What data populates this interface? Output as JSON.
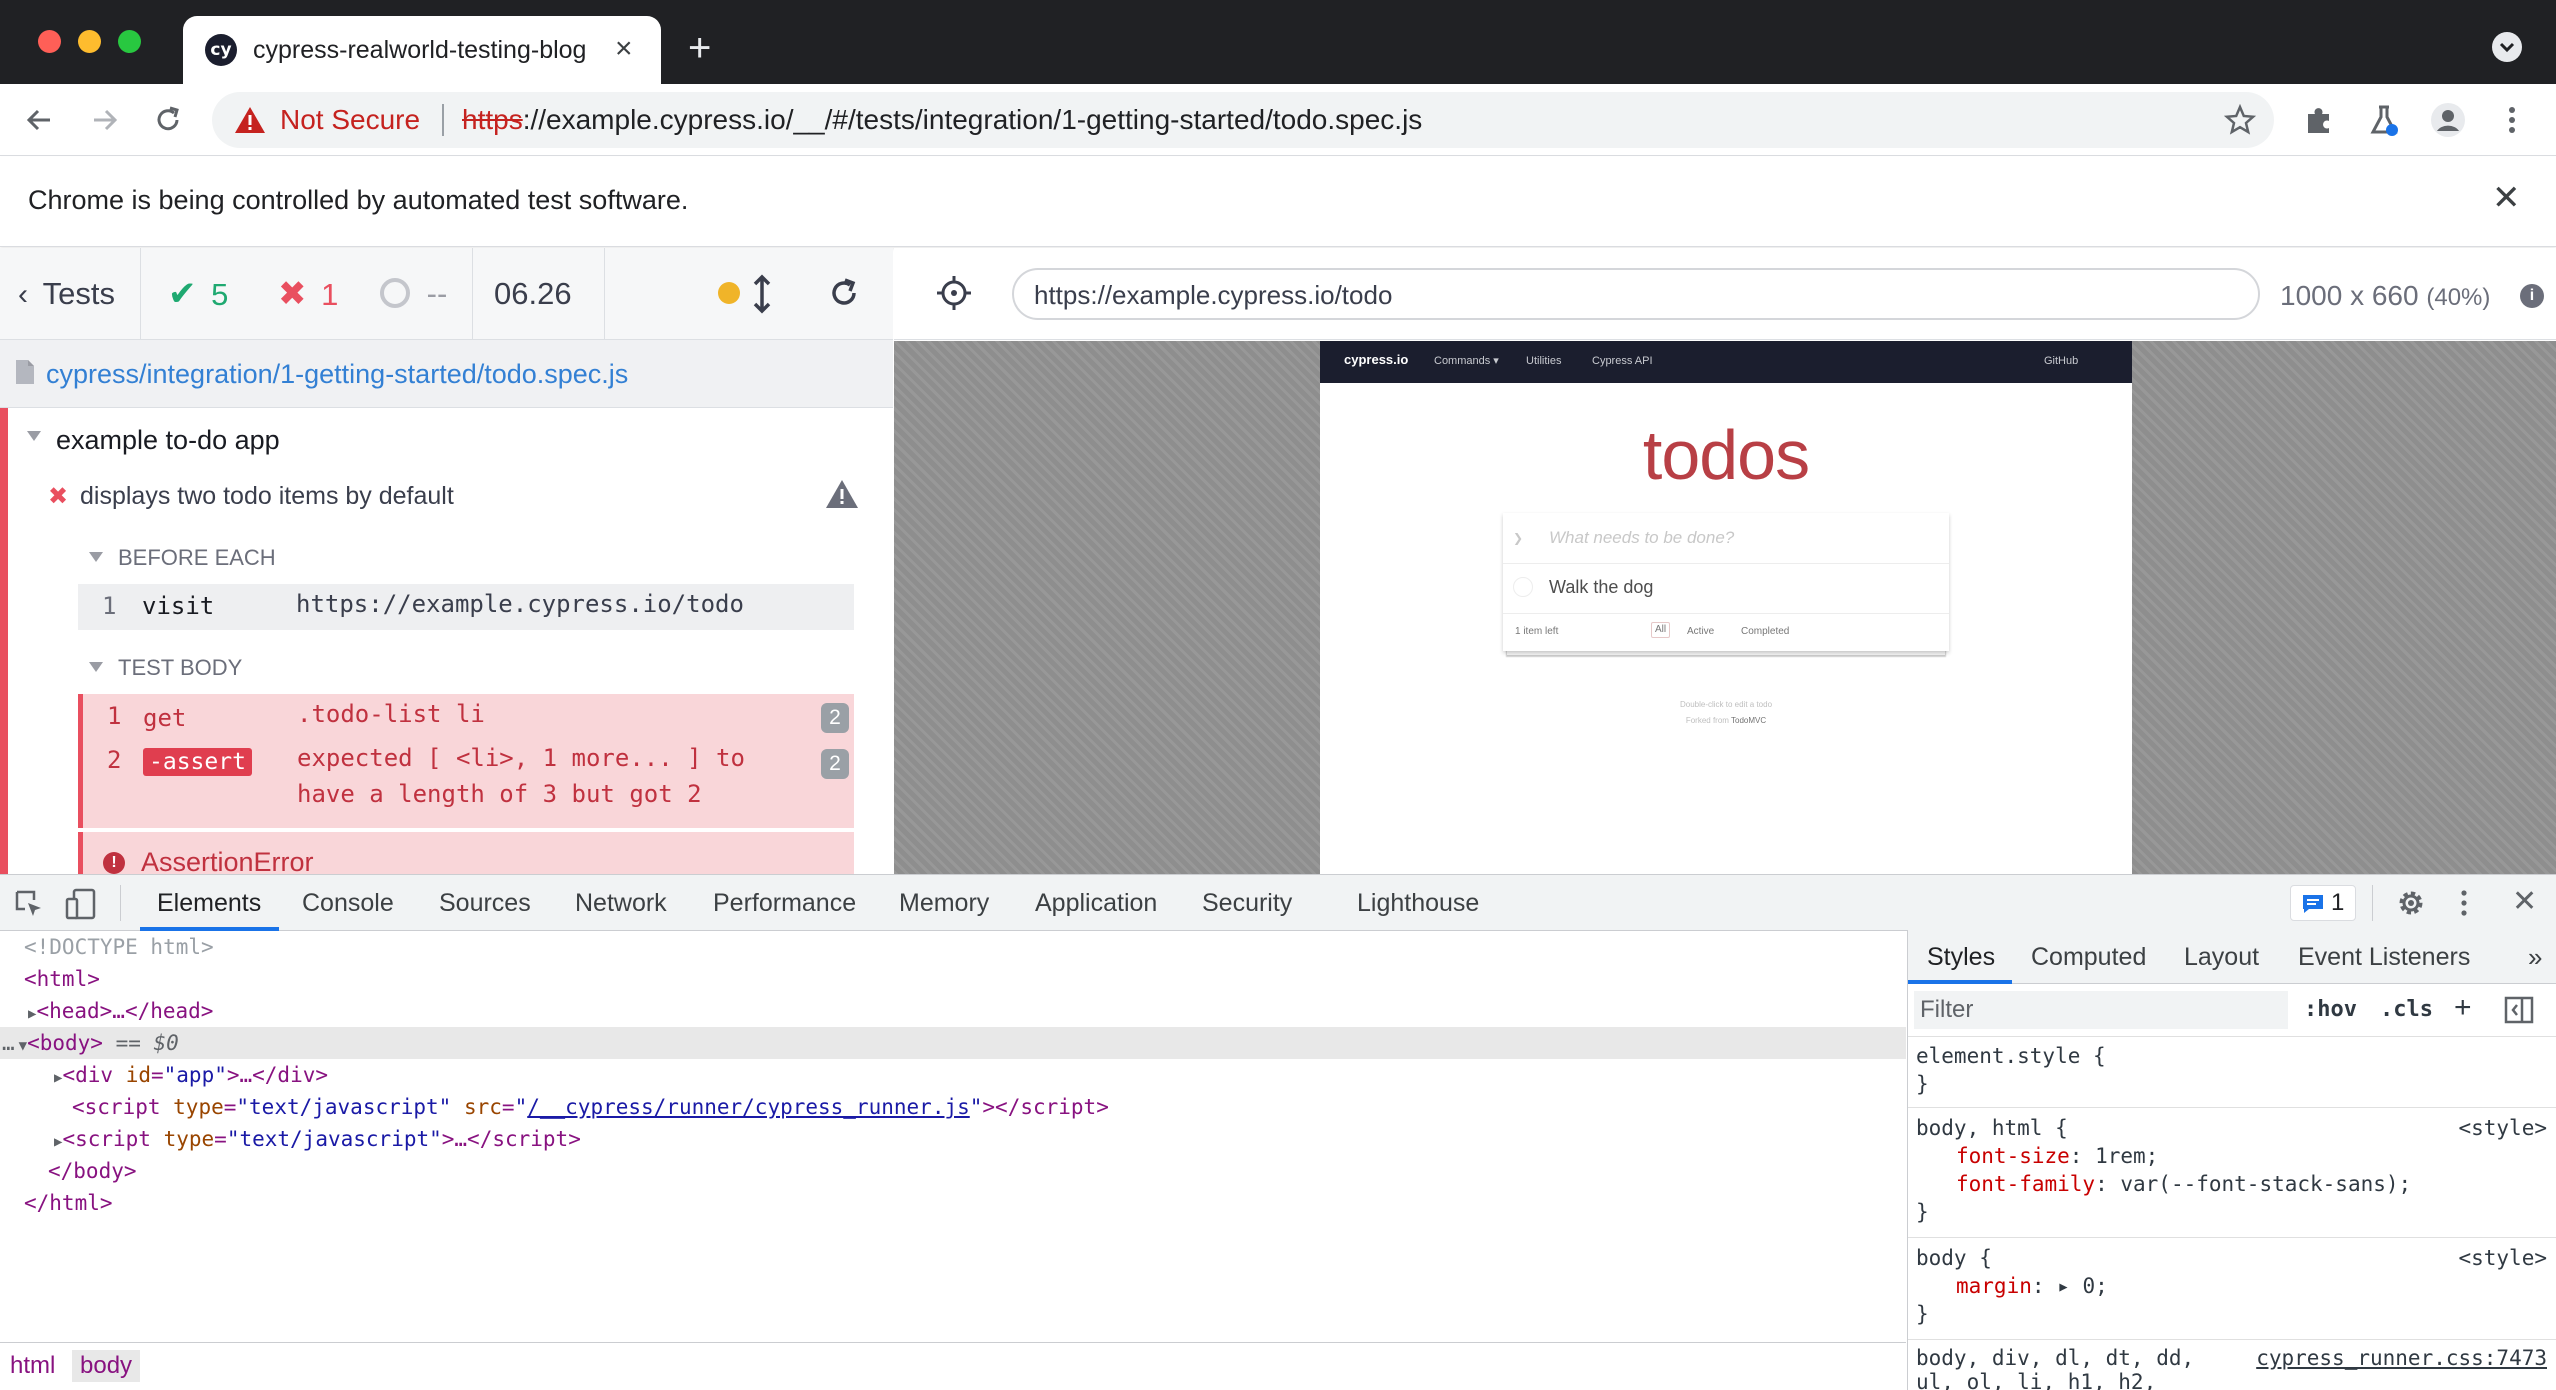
{
  "browser": {
    "tab_title": "cypress-realworld-testing-blog",
    "favicon_label": "cy",
    "url_security": "Not Secure",
    "url_scheme": "https",
    "url_rest": "://example.cypress.io/__/#/tests/integration/1-getting-started/todo.spec.js",
    "infobar_text": "Chrome is being controlled by automated test software."
  },
  "reporter": {
    "tests_label": "Tests",
    "passed": "5",
    "failed": "1",
    "pending": "--",
    "duration": "06.26",
    "spec_path": "cypress/integration/1-getting-started/todo.spec.js",
    "suite_title": "example to-do app",
    "test_title": "displays two todo items by default",
    "before_each_label": "BEFORE EACH",
    "before_each_commands": [
      {
        "num": "1",
        "name": "visit",
        "message": "https://example.cypress.io/todo"
      }
    ],
    "test_body_label": "TEST BODY",
    "test_body_commands": [
      {
        "num": "1",
        "name": "get",
        "message": ".todo-list li",
        "badge": "2"
      },
      {
        "num": "2",
        "name": "-assert",
        "message_line1": "expected [ <li>, 1 more... ] to",
        "message_line2": "have a length of 3 but got 2",
        "badge": "2"
      }
    ],
    "error_title": "AssertionError"
  },
  "aut": {
    "url": "https://example.cypress.io/todo",
    "viewport": "1000 x 660",
    "scale": "(40%)",
    "nav": {
      "brand": "cypress.io",
      "items": [
        "Commands ▾",
        "Utilities",
        "Cypress API"
      ],
      "github": "GitHub"
    },
    "todos_title": "todos",
    "new_todo_placeholder": "What needs to be done?",
    "todo_items": [
      "Walk the dog"
    ],
    "items_left": "1 item left",
    "filters": [
      "All",
      "Active",
      "Completed"
    ],
    "info_line1": "Double-click to edit a todo",
    "info_line2_prefix": "Forked from ",
    "info_line2_link": "TodoMVC"
  },
  "devtools": {
    "tabs": [
      "Elements",
      "Console",
      "Sources",
      "Network",
      "Performance",
      "Memory",
      "Application",
      "Security",
      "Lighthouse"
    ],
    "active_tab": "Elements",
    "issues_count": "1",
    "dom": {
      "doctype": "<!DOCTYPE html>",
      "html_open": "<html>",
      "head": "<head>…</head>",
      "body_open": "<body>",
      "body_marker": "== $0",
      "div_app_tag": "div",
      "div_app_attr": "id",
      "div_app_val": "\"app\"",
      "div_app_tail": ">…</div>",
      "script1_src": "/__cypress/runner/cypress_runner.js",
      "body_close": "</body>",
      "html_close": "</html>"
    },
    "breadcrumbs": [
      "html",
      "body"
    ],
    "styles_tabs": [
      "Styles",
      "Computed",
      "Layout",
      "Event Listeners"
    ],
    "filter_placeholder": "Filter",
    "hov": ":hov",
    "cls": ".cls",
    "rules": [
      {
        "selector": "element.style {",
        "close": "}"
      },
      {
        "selector": "body, html {",
        "source": "<style>",
        "props": [
          {
            "name": "font-size",
            "value": "1rem;"
          },
          {
            "name": "font-family",
            "value": "var(--font-stack-sans);"
          }
        ],
        "close": "}"
      },
      {
        "selector": "body {",
        "source": "<style>",
        "props": [
          {
            "name": "margin",
            "value": "▸ 0;"
          }
        ],
        "close": "}"
      },
      {
        "selector": "body, div, dl, dt, dd,",
        "selector2": "ul, ol, li, h1, h2,",
        "source": "cypress_runner.css:7473"
      }
    ]
  }
}
